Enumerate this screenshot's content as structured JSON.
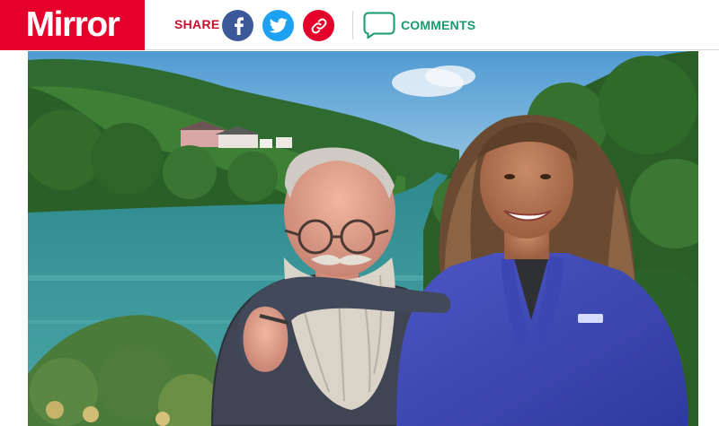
{
  "header": {
    "logo_text": "Mirror",
    "share_label": "SHARE",
    "comments_label": "COMMENTS"
  },
  "share_buttons": [
    {
      "network": "facebook",
      "icon": "facebook-icon",
      "color": "#3b5998"
    },
    {
      "network": "twitter",
      "icon": "twitter-icon",
      "color": "#1da1f2"
    },
    {
      "network": "link",
      "icon": "link-icon",
      "color": "#e4002b"
    }
  ],
  "colors": {
    "brand": "#e4002b",
    "comments": "#1a9a6c"
  },
  "hero_image": {
    "subject": "photo"
  }
}
